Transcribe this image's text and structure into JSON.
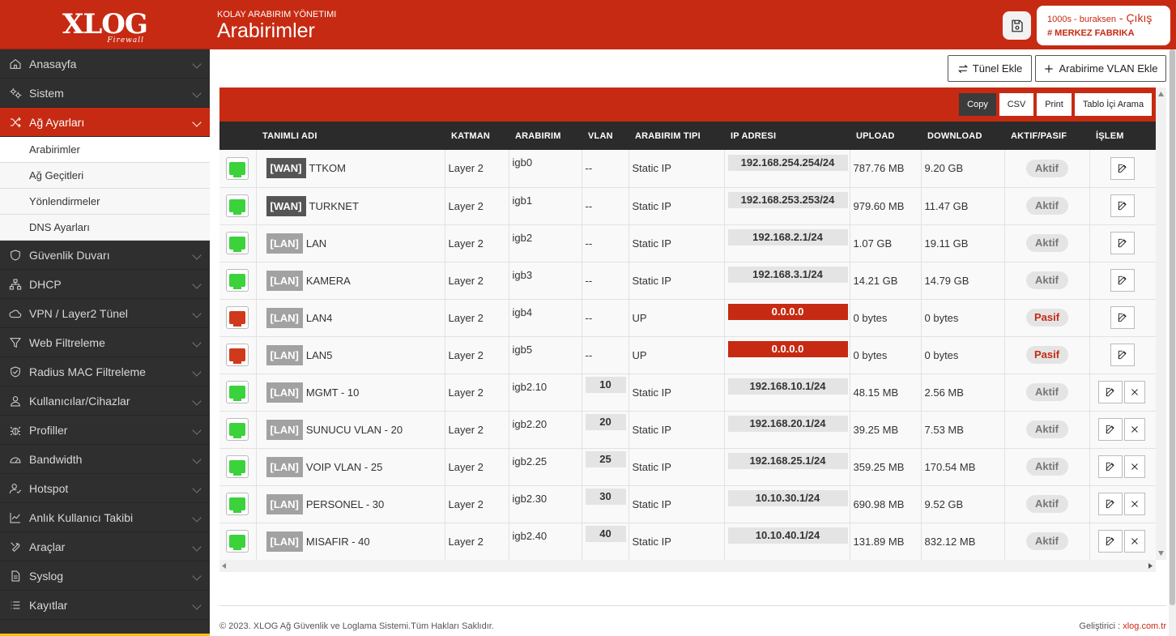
{
  "brand": {
    "logo_text": "XLOG",
    "logo_sub": "Firewall"
  },
  "sidebar": {
    "items": [
      {
        "label": "Anasayfa",
        "icon": "home-icon"
      },
      {
        "label": "Sistem",
        "icon": "cogs-icon"
      },
      {
        "label": "Ağ Ayarları",
        "icon": "shuffle-icon",
        "active": true
      },
      {
        "label": "Güvenlik Duvarı",
        "icon": "shield-icon"
      },
      {
        "label": "DHCP",
        "icon": "sitemap-icon"
      },
      {
        "label": "VPN / Layer2 Tünel",
        "icon": "cloud-icon"
      },
      {
        "label": "Web Filtreleme",
        "icon": "filter-icon"
      },
      {
        "label": "Radius MAC Filtreleme",
        "icon": "shield-check-icon"
      },
      {
        "label": "Kullanıcılar/Cihazlar",
        "icon": "user-icon"
      },
      {
        "label": "Profiller",
        "icon": "bug-icon"
      },
      {
        "label": "Bandwidth",
        "icon": "gauge-icon"
      },
      {
        "label": "Hotspot",
        "icon": "user-check-icon"
      },
      {
        "label": "Anlık Kullanıcı Takibi",
        "icon": "chart-line-icon"
      },
      {
        "label": "Araçlar",
        "icon": "tools-icon"
      },
      {
        "label": "Syslog",
        "icon": "file-icon"
      },
      {
        "label": "Kayıtlar",
        "icon": "list-icon"
      }
    ],
    "subitems": [
      "Arabirimler",
      "Ağ Geçitleri",
      "Yönlendirmeler",
      "DNS Ayarları"
    ]
  },
  "header": {
    "subtitle": "KOLAY ARABIRIM YÖNETIMI",
    "title": "Arabirimler",
    "user": "1000s - buraksen",
    "logout": " - Çıkış",
    "location": "# MERKEZ FABRIKA"
  },
  "toolbar": {
    "tunnel_label": "Tünel Ekle",
    "vlan_label": "Arabirime VLAN Ekle"
  },
  "datatable_buttons": [
    "Copy",
    "CSV",
    "Print",
    "Tablo İçi Arama"
  ],
  "table": {
    "columns": [
      "",
      "TANIMLI ADI",
      "KATMAN",
      "ARABIRIM",
      "VLAN",
      "ARABIRIM TIPI",
      "IP ADRESI",
      "UPLOAD",
      "DOWNLOAD",
      "AKTIF/PASIF",
      "İŞLEM"
    ],
    "rows": [
      {
        "port": "green",
        "tag": "[WAN]",
        "name": "TTKOM",
        "layer": "Layer 2",
        "iface": "igb0",
        "vlan": "--",
        "type": "Static IP",
        "ip": "192.168.254.254/24",
        "upload": "787.76 MB",
        "download": "9.20 GB",
        "status": "Aktif",
        "deletable": false
      },
      {
        "port": "green",
        "tag": "[WAN]",
        "name": "TURKNET",
        "layer": "Layer 2",
        "iface": "igb1",
        "vlan": "--",
        "type": "Static IP",
        "ip": "192.168.253.253/24",
        "upload": "979.60 MB",
        "download": "11.47 GB",
        "status": "Aktif",
        "deletable": false
      },
      {
        "port": "green",
        "tag": "[LAN]",
        "name": "LAN",
        "layer": "Layer 2",
        "iface": "igb2",
        "vlan": "--",
        "type": "Static IP",
        "ip": "192.168.2.1/24",
        "upload": "1.07 GB",
        "download": "19.11 GB",
        "status": "Aktif",
        "deletable": false
      },
      {
        "port": "green",
        "tag": "[LAN]",
        "name": "KAMERA",
        "layer": "Layer 2",
        "iface": "igb3",
        "vlan": "--",
        "type": "Static IP",
        "ip": "192.168.3.1/24",
        "upload": "14.21 GB",
        "download": "14.79 GB",
        "status": "Aktif",
        "deletable": false
      },
      {
        "port": "red",
        "tag": "[LAN]",
        "name": "LAN4",
        "layer": "Layer 2",
        "iface": "igb4",
        "vlan": "--",
        "type": "UP",
        "ip": "0.0.0.0",
        "upload": "0 bytes",
        "download": "0 bytes",
        "status": "Pasif",
        "deletable": false
      },
      {
        "port": "red",
        "tag": "[LAN]",
        "name": "LAN5",
        "layer": "Layer 2",
        "iface": "igb5",
        "vlan": "--",
        "type": "UP",
        "ip": "0.0.0.0",
        "upload": "0 bytes",
        "download": "0 bytes",
        "status": "Pasif",
        "deletable": false
      },
      {
        "port": "green",
        "tag": "[LAN]",
        "name": "MGMT - 10",
        "layer": "Layer 2",
        "iface": "igb2.10",
        "vlan": "10",
        "type": "Static IP",
        "ip": "192.168.10.1/24",
        "upload": "48.15 MB",
        "download": "2.56 MB",
        "status": "Aktif",
        "deletable": true
      },
      {
        "port": "green",
        "tag": "[LAN]",
        "name": "SUNUCU VLAN - 20",
        "layer": "Layer 2",
        "iface": "igb2.20",
        "vlan": "20",
        "type": "Static IP",
        "ip": "192.168.20.1/24",
        "upload": "39.25 MB",
        "download": "7.53 MB",
        "status": "Aktif",
        "deletable": true
      },
      {
        "port": "green",
        "tag": "[LAN]",
        "name": "VOIP VLAN - 25",
        "layer": "Layer 2",
        "iface": "igb2.25",
        "vlan": "25",
        "type": "Static IP",
        "ip": "192.168.25.1/24",
        "upload": "359.25 MB",
        "download": "170.54 MB",
        "status": "Aktif",
        "deletable": true
      },
      {
        "port": "green",
        "tag": "[LAN]",
        "name": "PERSONEL - 30",
        "layer": "Layer 2",
        "iface": "igb2.30",
        "vlan": "30",
        "type": "Static IP",
        "ip": "10.10.30.1/24",
        "upload": "690.98 MB",
        "download": "9.52 GB",
        "status": "Aktif",
        "deletable": true
      },
      {
        "port": "green",
        "tag": "[LAN]",
        "name": "MISAFIR - 40",
        "layer": "Layer 2",
        "iface": "igb2.40",
        "vlan": "40",
        "type": "Static IP",
        "ip": "10.10.40.1/24",
        "upload": "131.89 MB",
        "download": "832.12 MB",
        "status": "Aktif",
        "deletable": true
      }
    ]
  },
  "footer": {
    "copyright": "© 2023. XLOG Ağ Güvenlik ve Loglama Sistemi.Tüm Hakları Saklıdır.",
    "dev_label": "Geliştirici : ",
    "dev_link": "xlog.com.tr"
  },
  "colors": {
    "brand": "#c72a12",
    "sidebar": "#2f2f2f",
    "port_green": "#3bd23b",
    "port_red": "#d0391b"
  }
}
